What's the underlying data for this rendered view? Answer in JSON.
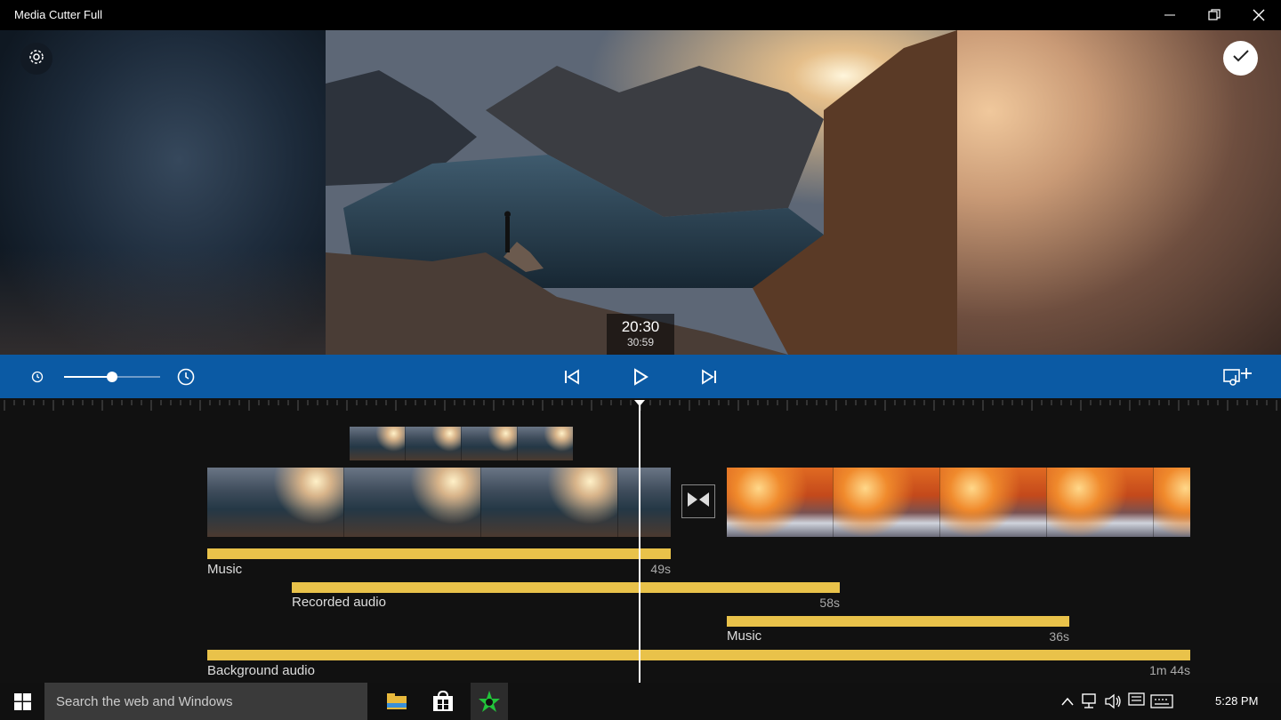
{
  "window": {
    "title": "Media Cutter Full"
  },
  "preview": {
    "time_main": "20:30",
    "time_sub": "30:59"
  },
  "icons": {
    "settings": "gear-icon",
    "confirm": "checkmark-icon",
    "minimize": "minimize-icon",
    "restore": "restore-icon",
    "close": "close-icon",
    "speed_small": "clock-small-icon",
    "speed_large": "clock-icon",
    "prev": "skip-previous-icon",
    "play": "play-icon",
    "next": "skip-next-icon",
    "add_media": "add-media-icon",
    "transition": "transition-icon"
  },
  "speed_slider": {
    "level": 0.5
  },
  "timeline": {
    "audio_tracks": [
      {
        "label": "Music",
        "duration": "49s"
      },
      {
        "label": "Recorded audio",
        "duration": "58s"
      },
      {
        "label": "Music",
        "duration": "36s"
      },
      {
        "label": "Background audio",
        "duration": "1m 44s"
      }
    ]
  },
  "taskbar": {
    "search_placeholder": "Search the web and Windows",
    "clock": "5:28 PM"
  },
  "colors": {
    "accent": "#0b5aa4",
    "audio_bar": "#e9c24a"
  }
}
